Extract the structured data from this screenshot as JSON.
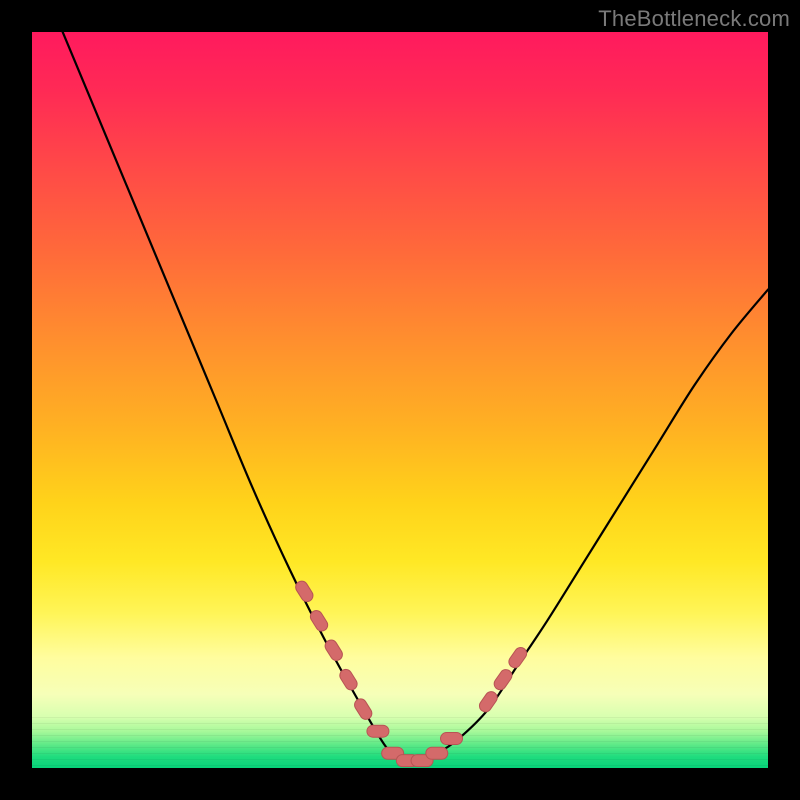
{
  "watermark": "TheBottleneck.com",
  "colors": {
    "frame": "#000000",
    "watermark_text": "#7a7a7a",
    "curve_stroke": "#000000",
    "marker_fill": "#d46a6a",
    "marker_stroke": "#b85454",
    "gradient_stops": [
      "#ff1a5e",
      "#ff4848",
      "#ff8f2e",
      "#ffd31a",
      "#fffd9e",
      "#a8f99a",
      "#1fdc7e"
    ]
  },
  "chart_data": {
    "type": "line",
    "title": "",
    "xlabel": "",
    "ylabel": "",
    "xlim": [
      0,
      100
    ],
    "ylim": [
      0,
      100
    ],
    "curve": {
      "name": "bottleneck-curve",
      "x": [
        0,
        5,
        10,
        15,
        20,
        25,
        30,
        35,
        40,
        45,
        48,
        50,
        52,
        55,
        58,
        62,
        66,
        70,
        75,
        80,
        85,
        90,
        95,
        100
      ],
      "y": [
        110,
        98,
        86,
        74,
        62,
        50,
        38,
        27,
        17,
        8,
        3,
        1,
        1,
        2,
        4,
        8,
        14,
        20,
        28,
        36,
        44,
        52,
        59,
        65
      ]
    },
    "markers": {
      "name": "highlighted-points",
      "x": [
        37,
        39,
        41,
        43,
        45,
        47,
        49,
        51,
        53,
        55,
        57,
        62,
        64,
        66
      ],
      "y": [
        24,
        20,
        16,
        12,
        8,
        5,
        2,
        1,
        1,
        2,
        4,
        9,
        12,
        15
      ]
    },
    "background_meaning": "vertical gradient encodes bottleneck severity; red=high, green=low"
  }
}
